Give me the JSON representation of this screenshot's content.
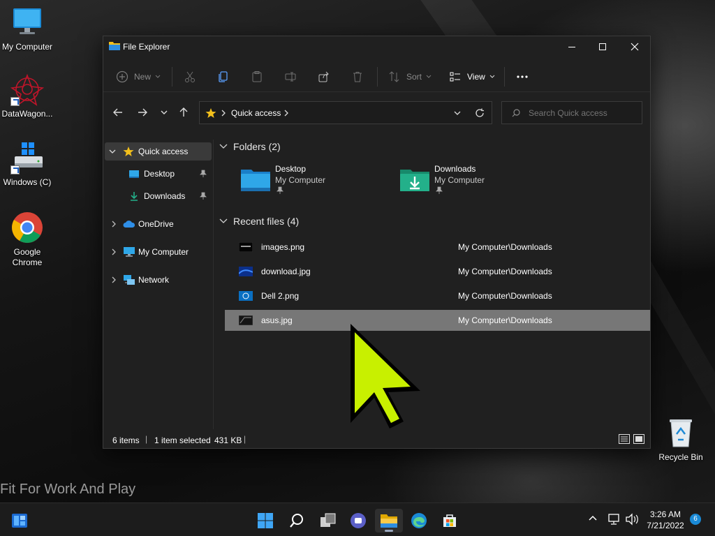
{
  "desktop": {
    "icons": [
      {
        "label": "My Computer",
        "icon": "monitor-icon"
      },
      {
        "label": "DataWagon...",
        "icon": "datawagon-icon",
        "shortcut": true
      },
      {
        "label": "Windows (C)",
        "icon": "drive-icon",
        "shortcut": true
      },
      {
        "label": "Google Chrome",
        "icon": "chrome-icon"
      },
      {
        "label": "Recycle Bin",
        "icon": "recycle-bin-icon"
      }
    ],
    "slogan": "Fit For Work And Play"
  },
  "explorer": {
    "title": "File Explorer",
    "toolbar": {
      "new_label": "New",
      "sort_label": "Sort",
      "view_label": "View"
    },
    "address": {
      "crumb": "Quick access"
    },
    "search": {
      "placeholder": "Search Quick access"
    },
    "sidebar": {
      "items": [
        {
          "label": "Quick access",
          "icon": "star-icon"
        },
        {
          "label": "Desktop",
          "icon": "desktop-folder-icon",
          "pinned": true
        },
        {
          "label": "Downloads",
          "icon": "download-arrow-icon",
          "pinned": true
        },
        {
          "label": "OneDrive",
          "icon": "onedrive-cloud-icon"
        },
        {
          "label": "My Computer",
          "icon": "computer-icon"
        },
        {
          "label": "Network",
          "icon": "network-icon"
        }
      ]
    },
    "folders_group": {
      "heading": "Folders (2)",
      "items": [
        {
          "name": "Desktop",
          "location": "My Computer"
        },
        {
          "name": "Downloads",
          "location": "My Computer"
        }
      ]
    },
    "recent_group": {
      "heading": "Recent files (4)",
      "items": [
        {
          "name": "images.png",
          "path": "My Computer\\Downloads"
        },
        {
          "name": "download.jpg",
          "path": "My Computer\\Downloads"
        },
        {
          "name": "Dell 2.png",
          "path": "My Computer\\Downloads"
        },
        {
          "name": "asus.jpg",
          "path": "My Computer\\Downloads",
          "selected": true
        }
      ]
    },
    "status": {
      "items": "6 items",
      "selection": "1 item selected",
      "size": "431 KB"
    }
  },
  "taskbar": {
    "time": "3:26 AM",
    "date": "7/21/2022",
    "notification_count": "6"
  },
  "colors": {
    "cursor": "#c8f000",
    "accent_folder": "#2fa7e8",
    "downloads_folder": "#23b08a",
    "star": "#f3c01c"
  }
}
